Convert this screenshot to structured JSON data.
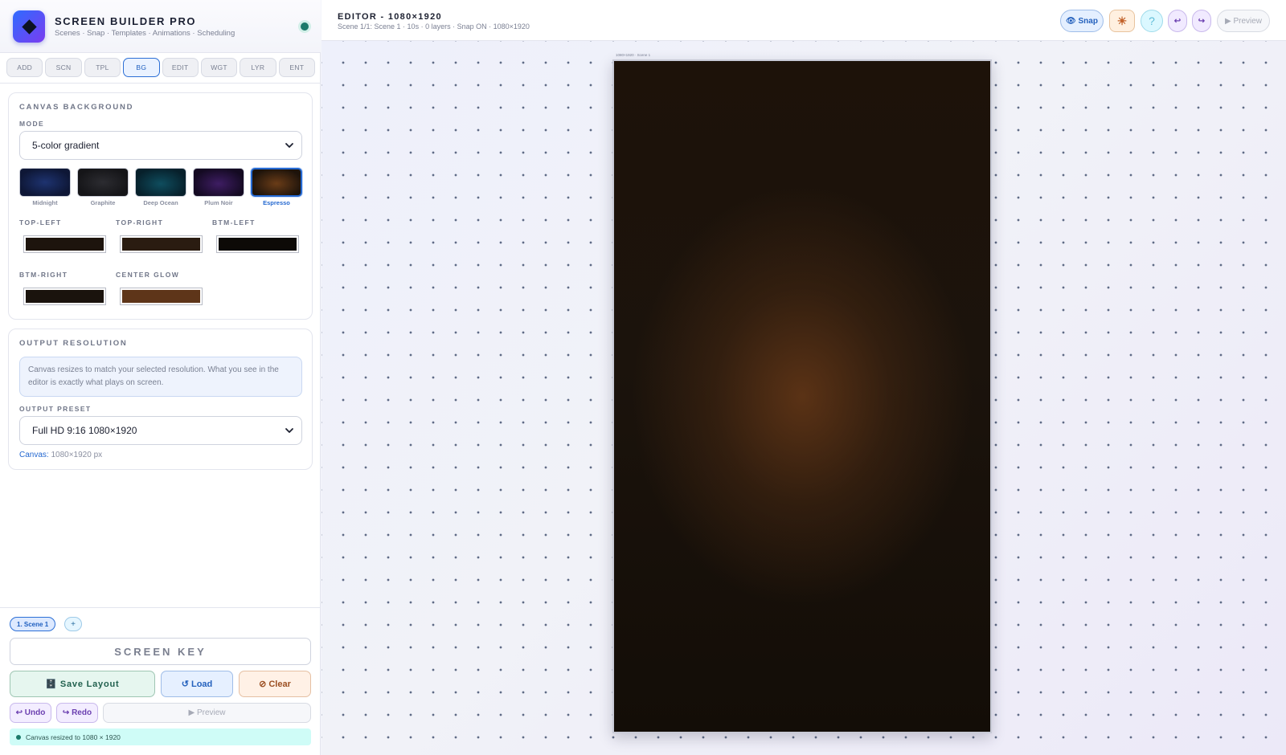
{
  "app": {
    "title": "SCREEN BUILDER PRO",
    "subtitle": "Scenes · Snap · Templates · Animations · Scheduling"
  },
  "tabs": [
    "ADD",
    "SCN",
    "TPL",
    "BG",
    "EDIT",
    "WGT",
    "LYR",
    "ENT"
  ],
  "active_tab": "BG",
  "background": {
    "section_title": "CANVAS BACKGROUND",
    "mode_label": "MODE",
    "mode_value": "5-color gradient",
    "presets": [
      {
        "name": "Midnight",
        "color": "#15244d"
      },
      {
        "name": "Graphite",
        "color": "#222226"
      },
      {
        "name": "Deep Ocean",
        "color": "#0d3a4a"
      },
      {
        "name": "Plum Noir",
        "color": "#2c1746"
      },
      {
        "name": "Espresso",
        "color": "#5a3314"
      }
    ],
    "active_preset": "Espresso",
    "slots": [
      {
        "label": "TOP-LEFT",
        "color": "#1d140d"
      },
      {
        "label": "TOP-RIGHT",
        "color": "#2a1c11"
      },
      {
        "label": "BTM-LEFT",
        "color": "#0d0a07"
      },
      {
        "label": "BTM-RIGHT",
        "color": "#1a130d"
      },
      {
        "label": "CENTER GLOW",
        "color": "#5e3519"
      }
    ]
  },
  "resolution": {
    "section_title": "OUTPUT RESOLUTION",
    "info": "Canvas resizes to match your selected resolution. What you see in the editor is exactly what plays on screen.",
    "preset_label": "OUTPUT PRESET",
    "preset_value": "Full HD 9:16 1080×1920",
    "canvas_key": "Canvas:",
    "canvas_value": "1080×1920 px"
  },
  "bottom": {
    "scene_chip": "1. Scene 1",
    "add_scene": "+",
    "screen_key": "SCREEN KEY",
    "save": "🗄️ Save Layout",
    "load": "↺ Load",
    "clear": "⊘ Clear",
    "undo": "↩ Undo",
    "redo": "↪ Redo",
    "preview": "▶ Preview",
    "status": "Canvas resized to 1080 × 1920"
  },
  "editor": {
    "title": "EDITOR - 1080×1920",
    "subtitle": "Scene 1/1: Scene 1 · 10s · 0 layers · Snap ON · 1080×1920",
    "snap": "👁 Snap",
    "theme_icon": "☀",
    "help_icon": "?",
    "undo": "↩",
    "redo": "↪",
    "preview": "▶ Preview",
    "canvas_tag": "1080×1920 · Scene 1"
  },
  "colors": {
    "accent": "#2468d0",
    "status_green": "#1b7a6a"
  }
}
